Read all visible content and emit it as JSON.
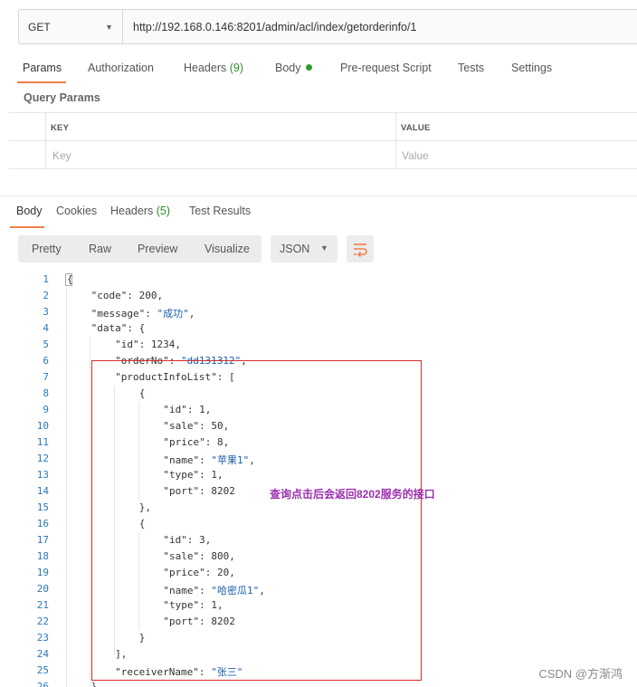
{
  "request": {
    "method": "GET",
    "url": "http://192.168.0.146:8201/admin/acl/index/getorderinfo/1"
  },
  "request_tabs": [
    {
      "label": "Params"
    },
    {
      "label": "Authorization"
    },
    {
      "label": "Headers",
      "count": "(9)"
    },
    {
      "label": "Body"
    },
    {
      "label": "Pre-request Script"
    },
    {
      "label": "Tests"
    },
    {
      "label": "Settings"
    }
  ],
  "query_params": {
    "title": "Query Params",
    "key_header": "KEY",
    "value_header": "VALUE",
    "key_placeholder": "Key",
    "value_placeholder": "Value"
  },
  "response_tabs": [
    {
      "label": "Body"
    },
    {
      "label": "Cookies"
    },
    {
      "label": "Headers",
      "count": "(5)"
    },
    {
      "label": "Test Results"
    }
  ],
  "viewer": {
    "modes": [
      "Pretty",
      "Raw",
      "Preview",
      "Visualize"
    ],
    "format": "JSON"
  },
  "code_lines": [
    "{",
    "\"code\": 200,",
    "\"message\": \"成功\",",
    "\"data\": {",
    "\"id\": 1234,",
    "\"orderNo\": \"dd131312\",",
    "\"productInfoList\": [",
    "{",
    "\"id\": 1,",
    "\"sale\": 50,",
    "\"price\": 8,",
    "\"name\": \"苹果1\",",
    "\"type\": 1,",
    "\"port\": 8202",
    "},",
    "{",
    "\"id\": 3,",
    "\"sale\": 800,",
    "\"price\": 20,",
    "\"name\": \"哈密瓜1\",",
    "\"type\": 1,",
    "\"port\": 8202",
    "}",
    "],",
    "\"receiverName\": \"张三\"",
    "}"
  ],
  "annotation": "查询点击后会返回8202服务的接口",
  "watermark": "CSDN @方渐鸿",
  "colors": {
    "accent_underline": "#f07e4b",
    "count_green": "#2d8e2d",
    "annotation_box": "#d52b2b",
    "annotation_text": "#9b2fae"
  }
}
